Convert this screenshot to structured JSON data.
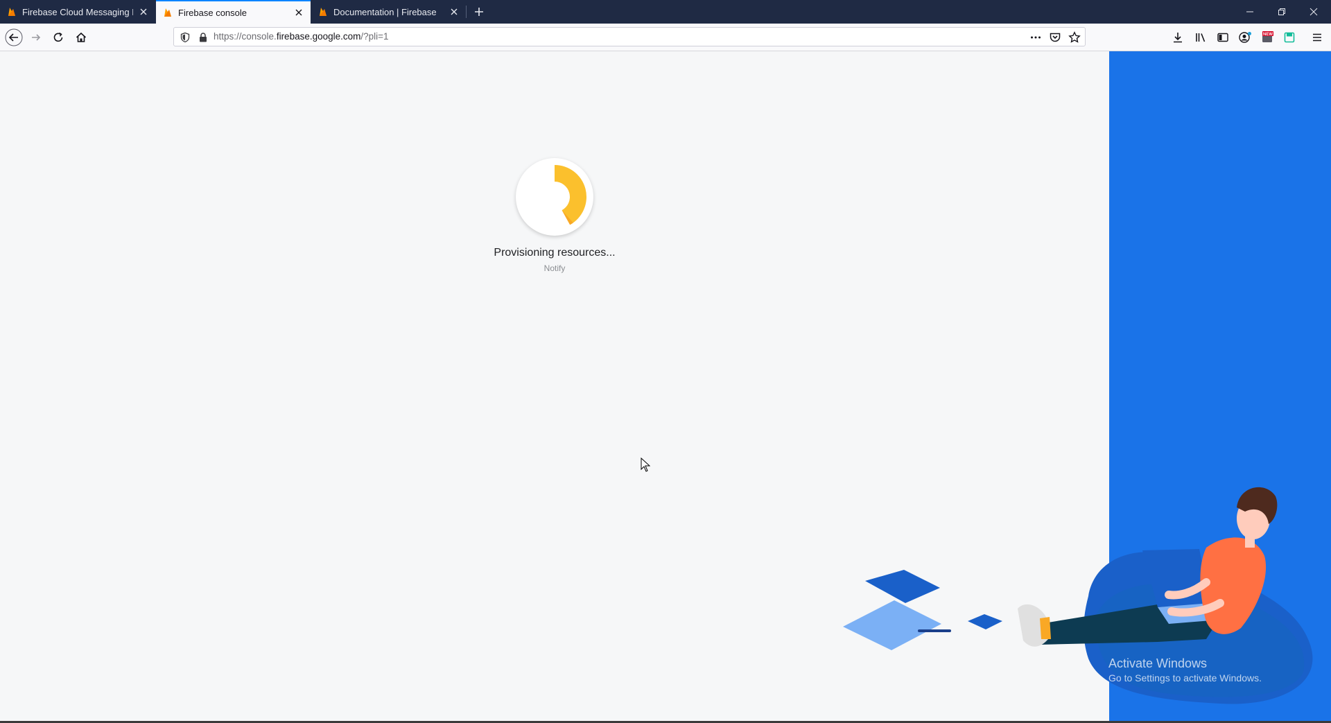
{
  "browser": {
    "tabs": [
      {
        "title": "Firebase Cloud Messaging HTT",
        "active": false
      },
      {
        "title": "Firebase console",
        "active": true
      },
      {
        "title": "Documentation | Firebase",
        "active": false
      }
    ],
    "url": {
      "prefix": "https://console.",
      "domain": "firebase.google.com",
      "suffix": "/?pli=1"
    },
    "badge_new": "NEW"
  },
  "loading": {
    "status": "Provisioning resources...",
    "project": "Notify",
    "progress_fraction": 0.42
  },
  "watermark": {
    "line1": "Activate Windows",
    "line2": "Go to Settings to activate Windows."
  },
  "colors": {
    "tabbar": "#1f2a44",
    "accent_blue": "#1a73e8",
    "spinner_yellow": "#fbc02d",
    "spinner_orange": "#f9a825"
  },
  "icons": [
    "firefox-fire-icon",
    "close-icon",
    "plus-icon",
    "minimize-icon",
    "restore-icon",
    "back-arrow-icon",
    "forward-arrow-icon",
    "reload-icon",
    "home-icon",
    "shield-icon",
    "lock-icon",
    "more-icon",
    "pocket-icon",
    "star-icon",
    "download-icon",
    "library-icon",
    "sidebar-icon",
    "account-icon",
    "extension-icon",
    "menu-icon"
  ]
}
